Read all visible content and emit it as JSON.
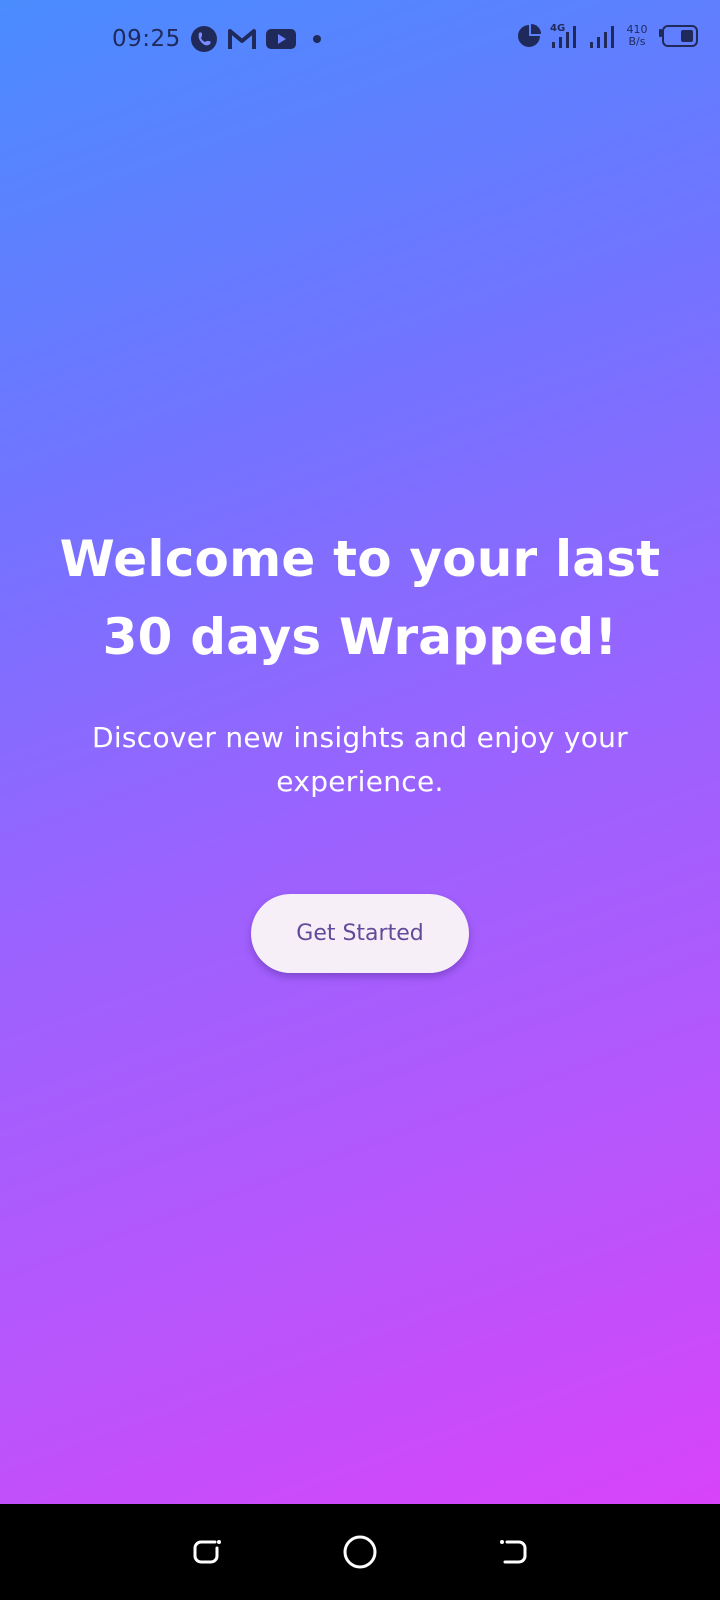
{
  "status_bar": {
    "time": "09:25",
    "left_icons": [
      "phone-call-icon",
      "gmail-icon",
      "youtube-icon",
      "notification-dot"
    ],
    "right_icons": [
      "data-usage-icon",
      "signal-4g-icon",
      "signal-icon",
      "battery-icon"
    ],
    "net_speed_value": "410",
    "net_speed_unit": "B/s",
    "network_type": "4G"
  },
  "main": {
    "headline": "Welcome to your last 30 days Wrapped!",
    "subtitle": "Discover new insights and enjoy your experience.",
    "cta_label": "Get Started"
  },
  "nav_bar": {
    "buttons": [
      "recents-button",
      "home-button",
      "back-button"
    ]
  },
  "colors": {
    "gradient_top": "#4a8cff",
    "gradient_mid": "#9a63ff",
    "gradient_bottom": "#e03ff8",
    "cta_background": "#f7eff8",
    "cta_text": "#5f4b9a",
    "status_icon": "#1f2a5a"
  }
}
